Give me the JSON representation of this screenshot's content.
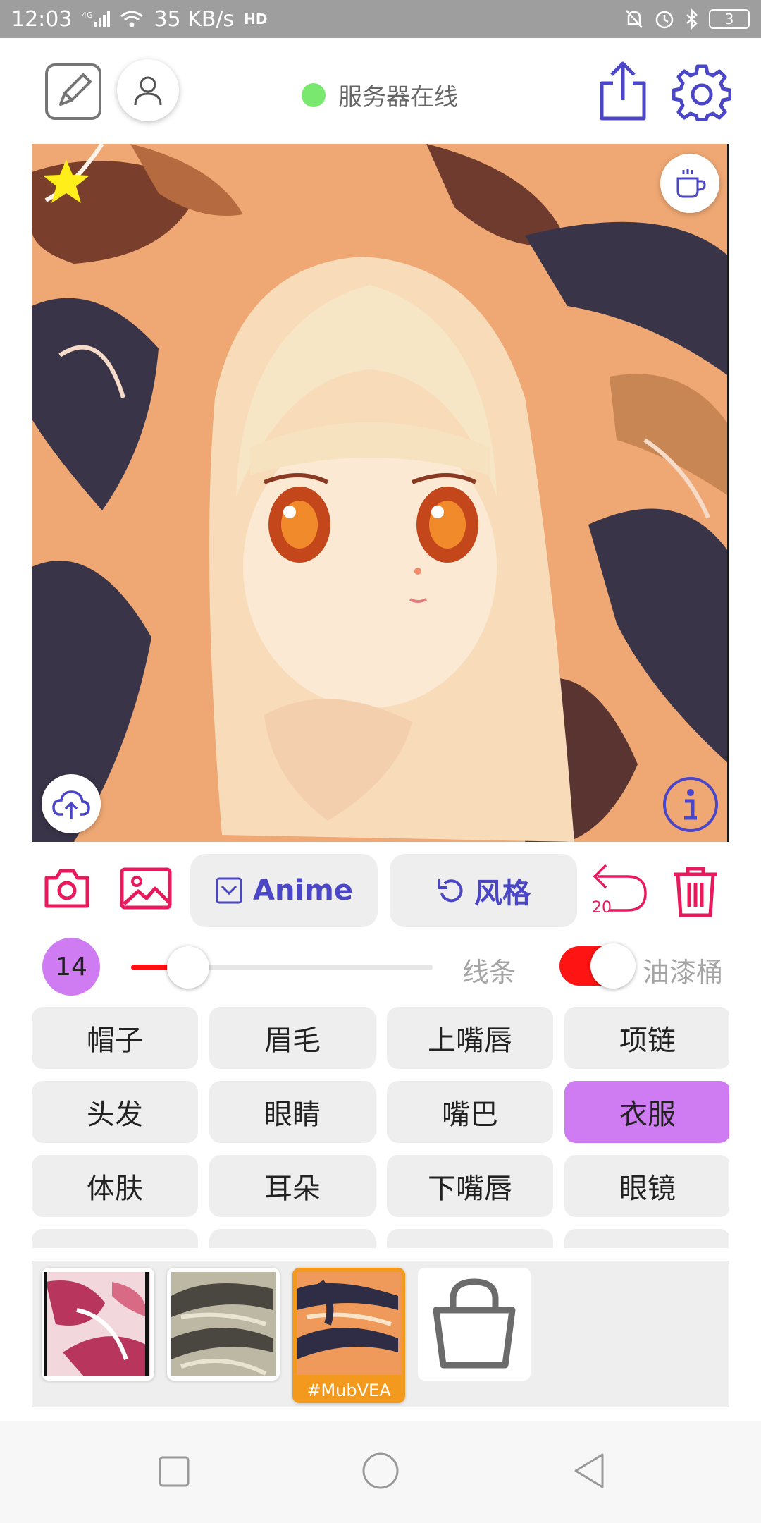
{
  "status_bar": {
    "time": "12:03",
    "network": "4G",
    "speed": "35 KB/s",
    "hd": "HD",
    "battery": "3"
  },
  "header": {
    "server_status": "服务器在线",
    "server_color": "#79e86f"
  },
  "icons": {
    "edit": "edit-icon",
    "user": "user-icon",
    "share": "share-icon",
    "settings": "gear-icon",
    "star": "star-icon",
    "coffee": "coffee-icon",
    "upload": "cloud-upload-icon",
    "info": "info-icon"
  },
  "toolbar": {
    "model_label": "Anime",
    "style_label": "风格",
    "undo_count": "20"
  },
  "brush": {
    "size": "14",
    "slider_fraction": 0.19,
    "lines_label": "线条",
    "bucket_label": "油漆桶",
    "bucket_enabled": true
  },
  "parts": [
    {
      "label": "帽子",
      "active": false
    },
    {
      "label": "眉毛",
      "active": false
    },
    {
      "label": "上嘴唇",
      "active": false
    },
    {
      "label": "项链",
      "active": false
    },
    {
      "label": "头发",
      "active": false
    },
    {
      "label": "眼睛",
      "active": false
    },
    {
      "label": "嘴巴",
      "active": false
    },
    {
      "label": "衣服",
      "active": true
    },
    {
      "label": "体肤",
      "active": false
    },
    {
      "label": "耳朵",
      "active": false
    },
    {
      "label": "下嘴唇",
      "active": false
    },
    {
      "label": "眼镜",
      "active": false
    }
  ],
  "style_thumbs": {
    "selected_tag": "#MubVEA"
  },
  "colors": {
    "accent_blue": "#4a46c7",
    "accent_red": "#e8195c",
    "highlight_purple": "#cf7bf2",
    "orange": "#f39a1e"
  }
}
